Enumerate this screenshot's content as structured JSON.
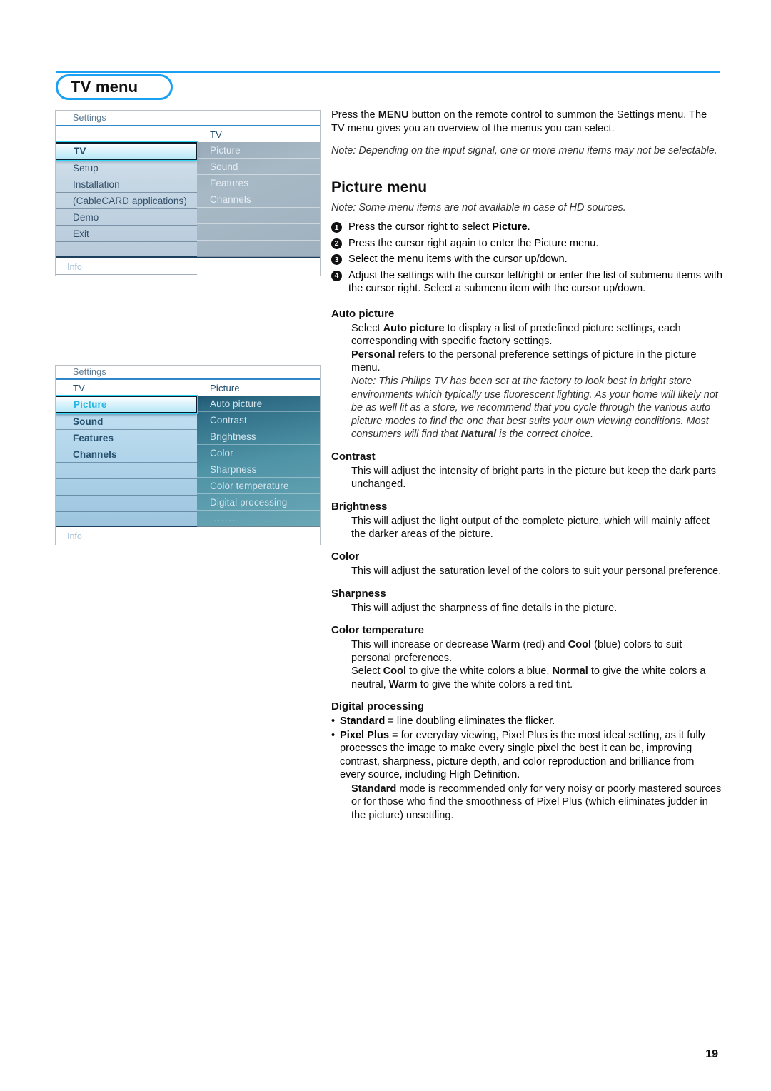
{
  "page": {
    "title": "TV menu",
    "number": "19",
    "accent_color": "#1ba1f2"
  },
  "tv_menu_screenshot": {
    "topbar_label": "Settings",
    "left_column_header": "",
    "right_column_header": "TV",
    "left_items": [
      "TV",
      "Setup",
      "Installation",
      "(CableCARD applications)",
      "Demo",
      "Exit"
    ],
    "left_selected": "TV",
    "right_items": [
      "Picture",
      "Sound",
      "Features",
      "Channels"
    ],
    "info_label": "Info"
  },
  "picture_menu_screenshot": {
    "topbar_label": "Settings",
    "left_column_header": "TV",
    "right_column_header": "Picture",
    "left_items": [
      "Picture",
      "Sound",
      "Features",
      "Channels"
    ],
    "left_selected": "Picture",
    "right_items": [
      "Auto picture",
      "Contrast",
      "Brightness",
      "Color",
      "Sharpness",
      "Color temperature",
      "Digital processing",
      "......."
    ],
    "info_label": "Info"
  },
  "intro": {
    "paragraph_html": "Press the <b>MENU</b> button on the remote control to summon the Settings menu. The TV menu gives you an overview of the menus you can select.",
    "note": "Note: Depending on the input signal, one or more menu items may not be selectable."
  },
  "picture_menu": {
    "heading": "Picture menu",
    "note": "Note: Some menu items are not available in case of HD sources.",
    "steps": [
      {
        "num": "1",
        "html": "Press the cursor right to select <b>Picture</b>."
      },
      {
        "num": "2",
        "html": "Press the cursor right again to enter the Picture menu."
      },
      {
        "num": "3",
        "html": "Select the menu items with the cursor up/down."
      },
      {
        "num": "4",
        "html": "Adjust the settings with the cursor left/right or enter the list of submenu items with the cursor right. Select a submenu item with the cursor up/down."
      }
    ]
  },
  "sections": {
    "auto_picture": {
      "heading": "Auto picture",
      "body_html": "Select <b>Auto picture</b> to display a list of predefined picture settings, each corresponding with specific factory settings.<br><b>Personal</b> refers to the personal preference settings of picture in the picture menu.",
      "note_html": "Note: This Philips TV has been set at the factory to look best in bright store environments which typically use fluorescent lighting. As your home will likely not be as well lit as a store, we recommend that you cycle through the various auto picture modes to find the one that best suits your own viewing conditions. Most consumers will find that <b>Natural</b> is the correct choice."
    },
    "contrast": {
      "heading": "Contrast",
      "body_html": "This will adjust the intensity of bright parts in the picture but keep the dark parts unchanged."
    },
    "brightness": {
      "heading": "Brightness",
      "body_html": "This will adjust the light output of the complete picture, which will mainly affect the darker areas of the picture."
    },
    "color": {
      "heading": "Color",
      "body_html": "This will adjust the saturation level of the colors to suit your personal preference."
    },
    "sharpness": {
      "heading": "Sharpness",
      "body_html": "This will adjust the sharpness of fine details in the picture."
    },
    "color_temperature": {
      "heading": "Color temperature",
      "body_html": "This will increase or decrease <b>Warm</b> (red) and <b>Cool</b> (blue) colors to suit personal preferences.<br>Select <b>Cool</b> to give the white colors a blue, <b>Normal</b> to give the white colors a neutral, <b>Warm</b> to give the white colors a red tint."
    },
    "digital_processing": {
      "heading": "Digital processing",
      "bullets": [
        "<b>Standard</b> = line doubling eliminates the flicker.",
        "<b>Pixel Plus</b> = for everyday viewing, Pixel Plus is the most ideal setting, as it fully processes the image to make every single pixel the best it can be, improving contrast, sharpness, picture depth, and color reproduction and brilliance from every source, including High Definition."
      ],
      "trailing_html": "<b>Standard</b> mode is recommended only for very noisy or poorly mastered sources or for those who find the smoothness of Pixel Plus (which eliminates judder in the picture) unsettling."
    }
  }
}
